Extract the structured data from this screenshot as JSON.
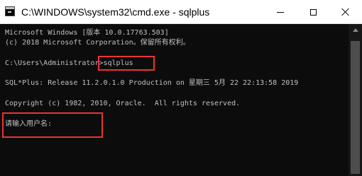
{
  "window": {
    "title": "C:\\WINDOWS\\system32\\cmd.exe - sqlplus"
  },
  "console": {
    "lines": [
      "Microsoft Windows [版本 10.0.17763.503]",
      "(c) 2018 Microsoft Corporation。保留所有权利。",
      "C:\\Users\\Administrator>sqlplus",
      "SQL*Plus: Release 11.2.0.1.0 Production on 星期三 5月 22 22:13:58 2019",
      "Copyright (c) 1982, 2010, Oracle.  All rights reserved.",
      "请输入用户名:"
    ]
  },
  "colors": {
    "highlight": "#ee3333",
    "console_bg": "#0c0c0c",
    "console_text": "#c0c0c0"
  }
}
